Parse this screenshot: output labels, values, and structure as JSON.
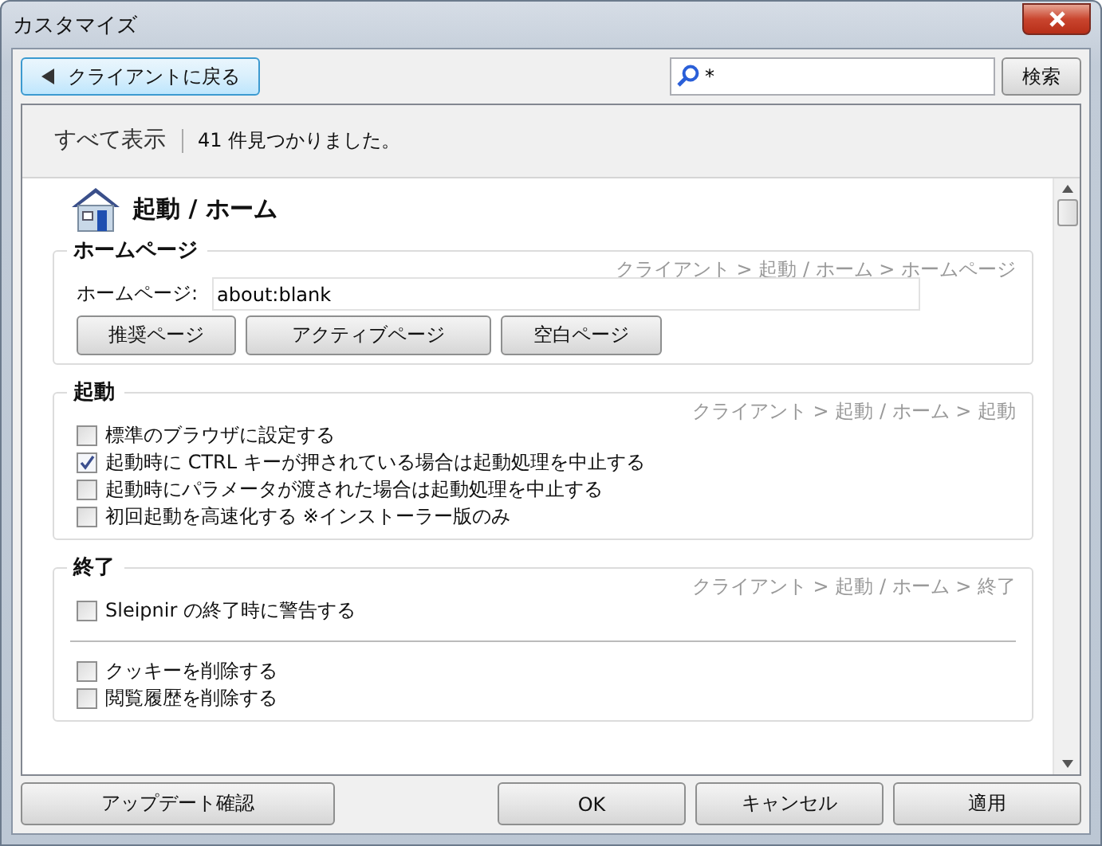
{
  "window": {
    "title": "カスタマイズ"
  },
  "toolbar": {
    "back_button": "クライアントに戻る",
    "search": {
      "value": "*"
    },
    "search_button": "検索"
  },
  "header": {
    "show_all": "すべて表示",
    "result_count": "41 件見つかりました。"
  },
  "section": {
    "title": "起動 / ホーム",
    "groups": [
      {
        "title": "ホームページ",
        "breadcrumb": "クライアント > 起動 / ホーム > ホームページ",
        "field": {
          "label": "ホームページ:",
          "value": "about:blank"
        },
        "buttons": [
          "推奨ページ",
          "アクティブページ",
          "空白ページ"
        ]
      },
      {
        "title": "起動",
        "breadcrumb": "クライアント > 起動 / ホーム > 起動",
        "items": [
          {
            "kind": "checkbox",
            "label": "標準のブラウザに設定する",
            "checked": false
          },
          {
            "kind": "checkbox",
            "label": "起動時に CTRL キーが押されている場合は起動処理を中止する",
            "checked": true
          },
          {
            "kind": "checkbox",
            "label": "起動時にパラメータが渡された場合は起動処理を中止する",
            "checked": false
          },
          {
            "kind": "checkbox",
            "label": "初回起動を高速化する ※インストーラー版のみ",
            "checked": false
          }
        ]
      },
      {
        "title": "終了",
        "breadcrumb": "クライアント > 起動 / ホーム > 終了",
        "items": [
          {
            "kind": "checkbox",
            "label": "Sleipnir の終了時に警告する",
            "checked": false
          },
          {
            "kind": "divider"
          },
          {
            "kind": "checkbox",
            "label": "クッキーを削除する",
            "checked": false
          },
          {
            "kind": "checkbox",
            "label": "閲覧履歴を削除する",
            "checked": false
          }
        ]
      }
    ]
  },
  "footer": {
    "update_button": "アップデート確認",
    "buttons": [
      "OK",
      "キャンセル",
      "適用"
    ]
  }
}
